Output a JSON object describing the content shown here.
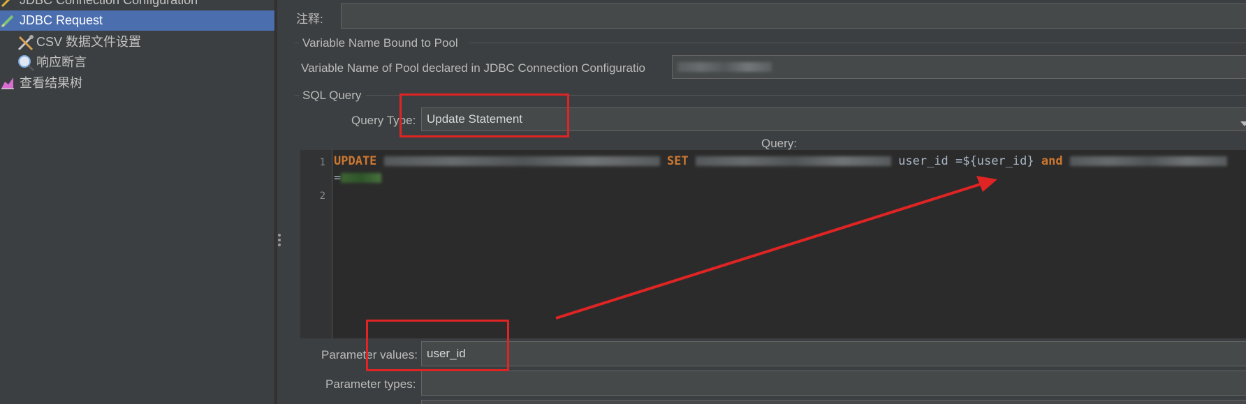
{
  "tree": {
    "items": [
      {
        "label": "JDBC Connection Configuration",
        "icon": "wrench-icon",
        "selected": false
      },
      {
        "label": "JDBC Request",
        "icon": "pencil-icon",
        "selected": true
      },
      {
        "label": "CSV 数据文件设置",
        "icon": "tools-icon",
        "selected": false
      },
      {
        "label": "响应断言",
        "icon": "magnifier-icon",
        "selected": false
      },
      {
        "label": "查看结果树",
        "icon": "chart-icon",
        "selected": false
      }
    ]
  },
  "form": {
    "comment_label": "注释:",
    "comment_value": "",
    "pool_group_title": "Variable Name Bound to Pool",
    "pool_label": "Variable Name of Pool declared in JDBC Connection Configuratio",
    "sql_group_title": "SQL Query",
    "query_type_label": "Query Type:",
    "query_type_value": "Update Statement",
    "query_label": "Query:",
    "param_values_label": "Parameter values:",
    "param_values_value": "user_id",
    "param_types_label": "Parameter types:",
    "param_types_value": ""
  },
  "editor": {
    "line_numbers": [
      "1",
      "2"
    ],
    "line1": {
      "kw_update": "UPDATE",
      "kw_set": "SET",
      "mid_text": "user_id =${user_id}",
      "kw_and": "and",
      "cont": "="
    }
  },
  "colors": {
    "accent_selected": "#4b6eaf",
    "annotation_red": "#e02424",
    "sql_keyword": "#cc7832"
  }
}
